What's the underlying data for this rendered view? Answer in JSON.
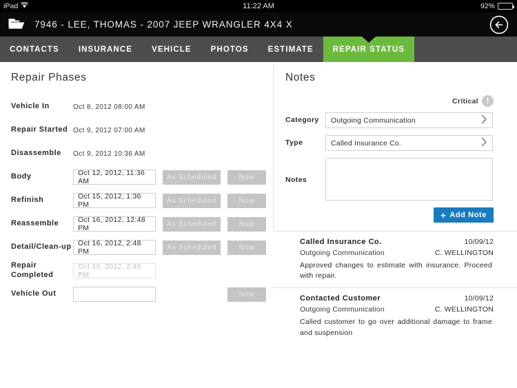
{
  "status_bar": {
    "carrier": "iPad",
    "wifi_icon": "wifi-icon",
    "time": "11:22 AM",
    "battery_percent": "92%",
    "battery_level": 92
  },
  "title_bar": {
    "folder_icon": "folder-icon",
    "job_title": "7946 - LEE, THOMAS - 2007 JEEP WRANGLER 4X4 X",
    "back_icon": "back-arrow-icon"
  },
  "tabs": [
    {
      "label": "CONTACTS",
      "active": false
    },
    {
      "label": "INSURANCE",
      "active": false
    },
    {
      "label": "VEHICLE",
      "active": false
    },
    {
      "label": "PHOTOS",
      "active": false
    },
    {
      "label": "ESTIMATE",
      "active": false
    },
    {
      "label": "REPAIR STATUS",
      "active": true
    }
  ],
  "left_panel": {
    "heading": "Repair Phases",
    "buttons": {
      "as_scheduled": "As Scheduled",
      "now": "Now"
    },
    "phases": [
      {
        "label": "Vehicle In",
        "kind": "static",
        "value": "Oct 8, 2012 08:00 AM"
      },
      {
        "label": "Repair Started",
        "kind": "static",
        "value": "Oct 9, 2012 07:00 AM"
      },
      {
        "label": "Disassemble",
        "kind": "static",
        "value": "Oct 9, 2012 10:36 AM"
      },
      {
        "label": "Body",
        "kind": "field",
        "value": "Oct 12, 2012, 11:36 AM",
        "as_scheduled": true,
        "now": true
      },
      {
        "label": "Refinish",
        "kind": "field",
        "value": "Oct 15, 2012, 1:36 PM",
        "as_scheduled": true,
        "now": true
      },
      {
        "label": "Reassemble",
        "kind": "field",
        "value": "Oct 16, 2012, 12:48 PM",
        "as_scheduled": true,
        "now": true
      },
      {
        "label": "Detail/Clean-up",
        "kind": "field",
        "value": "Oct 16, 2012, 2:48 PM",
        "as_scheduled": true,
        "now": true
      },
      {
        "label": "Repair Completed",
        "kind": "field",
        "value": "Oct 16, 2012, 2:48 PM",
        "disabled": true,
        "as_scheduled": false,
        "now": false
      },
      {
        "label": "Vehicle Out",
        "kind": "field",
        "value": "",
        "as_scheduled": false,
        "now": true
      }
    ]
  },
  "right_panel": {
    "heading": "Notes",
    "critical_label": "Critical",
    "critical_icon": "exclamation-circle-icon",
    "form": {
      "category_label": "Category",
      "category_value": "Outgoing Communication",
      "type_label": "Type",
      "type_value": "Called Insurance Co.",
      "notes_label": "Notes",
      "notes_value": "",
      "notes_placeholder": "",
      "add_note_label": "Add Note",
      "add_note_plus": "+",
      "chevron_icon": "chevron-right-icon"
    },
    "notes": [
      {
        "title": "Called Insurance Co.",
        "date": "10/09/12",
        "category": "Outgoing Communication",
        "author": "C. WELLINGTON",
        "body": "Approved changes to estimate with insurance. Proceed with repair."
      },
      {
        "title": "Contacted Customer",
        "date": "10/09/12",
        "category": "Outgoing Communication",
        "author": "C. WELLINGTON",
        "body": "Called customer to go over additional damage to frame and suspension"
      }
    ]
  },
  "colors": {
    "accent_green": "#6cba3d",
    "accent_blue": "#1a7bbd",
    "tab_bar": "#4d4d4d",
    "title_bar": "#0a0a0a",
    "button_gray": "#c4c4c4"
  }
}
